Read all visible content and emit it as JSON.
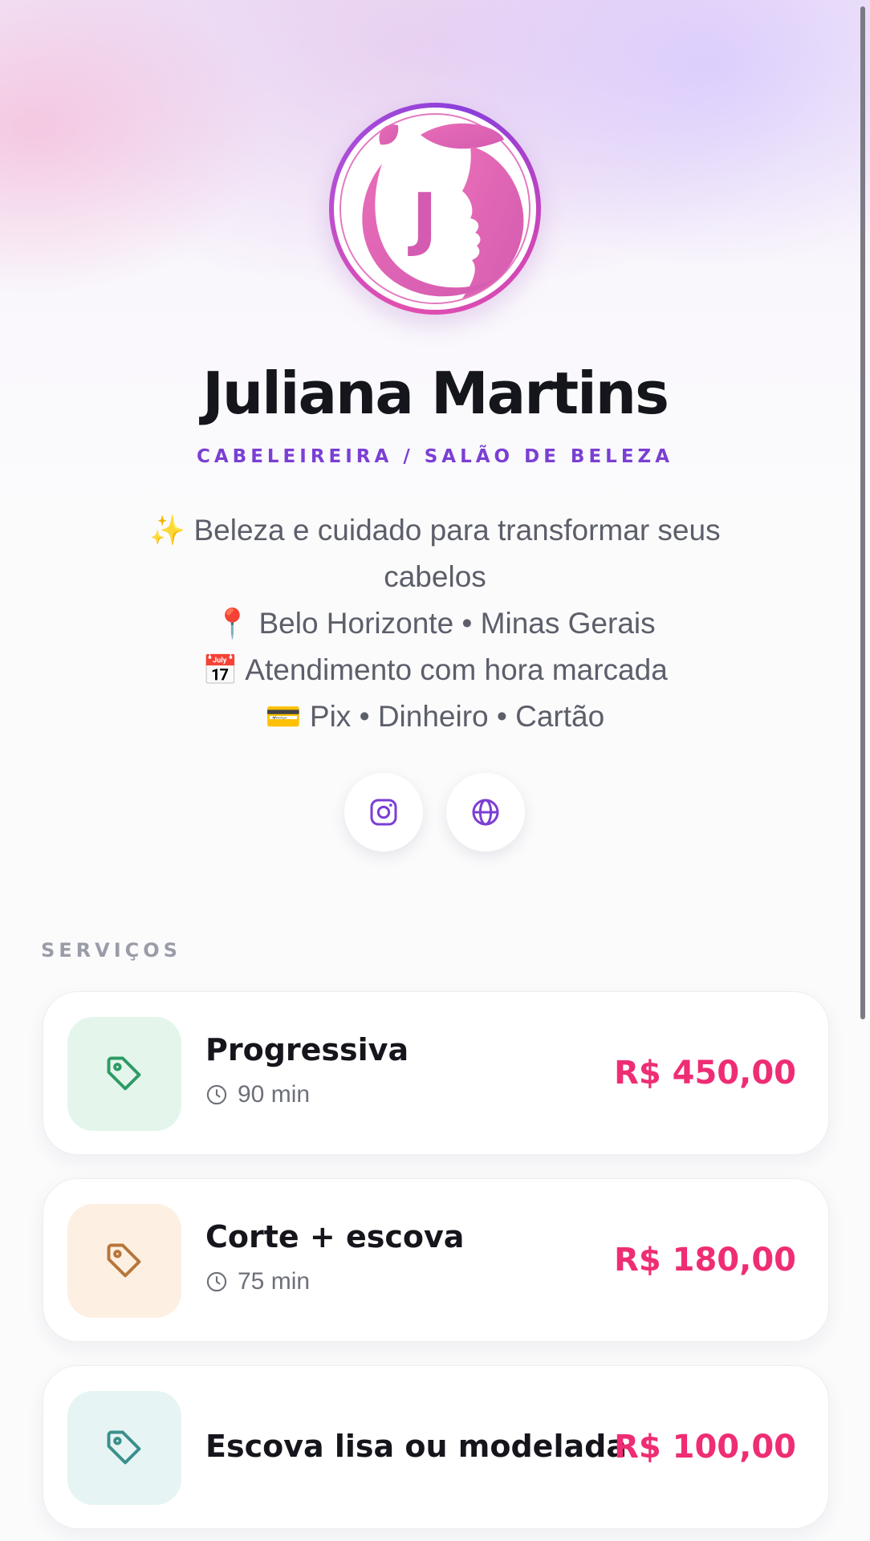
{
  "profile": {
    "name": "Juliana Martins",
    "role": "CABELEIREIRA / SALÃO DE BELEZA",
    "avatar_letter": "J",
    "bio": {
      "line1_emoji": "✨",
      "line1": "Beleza e cuidado para transformar seus",
      "line2": "cabelos",
      "line3_emoji": "📍",
      "line3": "Belo Horizonte • Minas Gerais",
      "line4_emoji": "📅",
      "line4": "Atendimento com hora marcada",
      "line5_emoji": "💳",
      "line5": "Pix • Dinheiro • Cartão"
    }
  },
  "social": [
    {
      "icon": "instagram-icon"
    },
    {
      "icon": "globe-icon"
    }
  ],
  "services": {
    "label": "SERVIÇOS",
    "items": [
      {
        "title": "Progressiva",
        "duration": "90 min",
        "price": "R$ 450,00",
        "icon": "tag-icon",
        "color": "#2e9a64",
        "bg": "#e4f6ec"
      },
      {
        "title": "Corte + escova",
        "duration": "75 min",
        "price": "R$ 180,00",
        "icon": "tag-icon",
        "color": "#b7753a",
        "bg": "#fdf0e2"
      },
      {
        "title": "Escova lisa ou modelada",
        "duration": "",
        "price": "R$ 100,00",
        "icon": "tag-icon",
        "color": "#3a8f8c",
        "bg": "#e6f4f4"
      }
    ]
  },
  "colors": {
    "accent_purple": "#7b3fd3",
    "price_pink": "#ee2d74"
  }
}
